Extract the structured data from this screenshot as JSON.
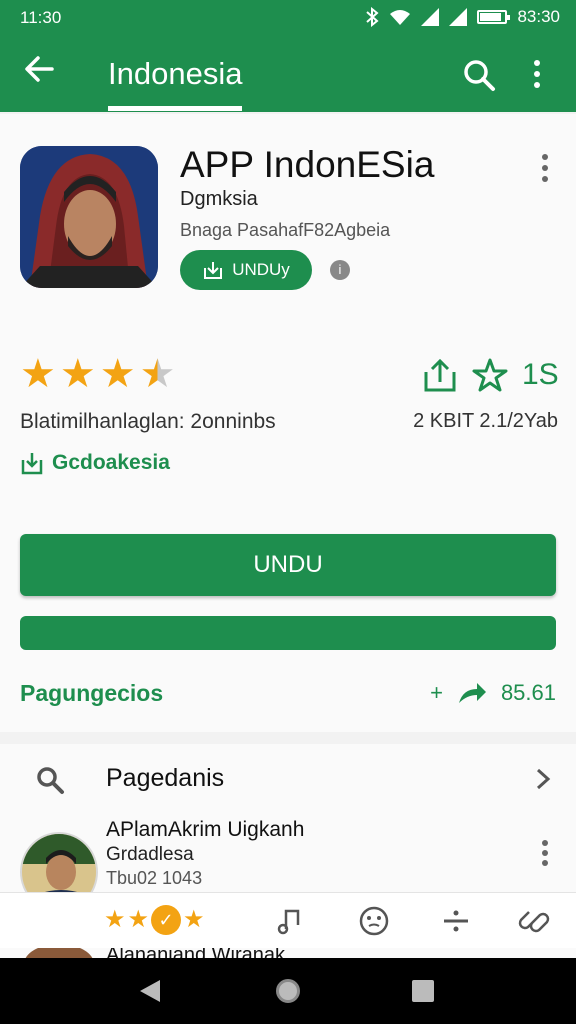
{
  "status_bar": {
    "time": "11:30",
    "clock_right": "83:30",
    "icons": [
      "bluetooth-icon",
      "wifi-icon",
      "signal-icon",
      "signal-icon",
      "battery-icon"
    ]
  },
  "app_bar": {
    "title": "Indonesia",
    "back_icon": "arrow-left-icon",
    "search_icon": "search-icon",
    "menu_icon": "more-vert-icon"
  },
  "app": {
    "name": "APP IndonESia",
    "developer": "Dgmksia",
    "meta": "Bnaga PasahafF82Agbeia",
    "chip_label": "UNDUy",
    "chip_icon": "download-box-icon",
    "info_badge": "i"
  },
  "rating": {
    "stars": 3.5,
    "share_count": "1S",
    "rating_text": "Blatimilhanlaglan: 2onninbs",
    "size_text": "2 KBIT 2.1/2Yab",
    "tag_label": "Gcdoakesia"
  },
  "actions": {
    "primary_label": "UNDU"
  },
  "related": {
    "label": "Pagungecios",
    "plus": "+",
    "count": "85.61"
  },
  "section": {
    "title": "Pagedanis"
  },
  "item": {
    "title": "APlamAkrim Uigkanh",
    "subtitle": "Grdadlesa",
    "meta": "Tbu02 1043",
    "badge": "3"
  },
  "toolbar": {
    "badge_glyph": "✓",
    "icons": [
      "music-note-icon",
      "smiley-icon",
      "divider-icon",
      "link-icon"
    ]
  },
  "peek": {
    "title": "Alananiand Wiranak"
  },
  "colors": {
    "primary": "#1e8e4e",
    "star": "#f3a313",
    "background": "#f2f2f2"
  }
}
